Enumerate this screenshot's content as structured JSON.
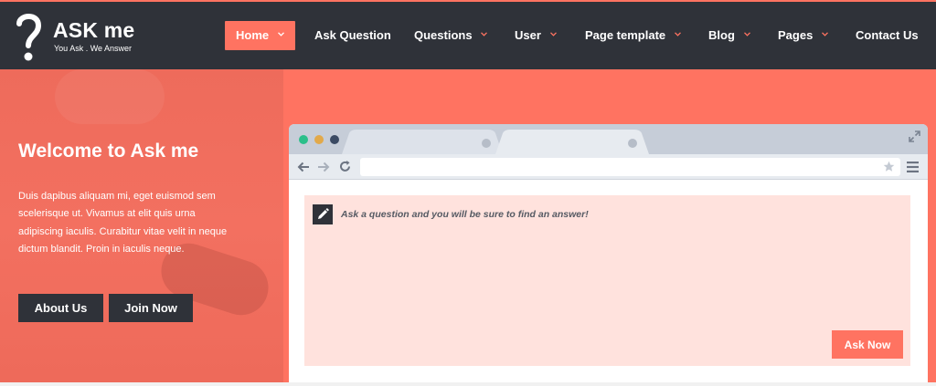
{
  "brand": {
    "name": "ASK me",
    "tagline": "You Ask . We Answer"
  },
  "nav": {
    "items": [
      {
        "label": "Home",
        "dropdown": true,
        "active": true
      },
      {
        "label": "Ask Question",
        "dropdown": false
      },
      {
        "label": "Questions",
        "dropdown": true
      },
      {
        "label": "User",
        "dropdown": true
      },
      {
        "label": "Page template",
        "dropdown": true
      },
      {
        "label": "Blog",
        "dropdown": true
      },
      {
        "label": "Pages",
        "dropdown": true
      },
      {
        "label": "Contact Us",
        "dropdown": false
      }
    ]
  },
  "hero": {
    "title": "Welcome to Ask me",
    "text": "Duis dapibus aliquam mi, eget euismod sem scelerisque ut. Vivamus at elit quis urna adipiscing iaculis. Curabitur vitae velit in neque dictum blandit. Proin in iaculis neque.",
    "buttons": {
      "about": "About Us",
      "join": "Join Now"
    }
  },
  "browser": {
    "url": "",
    "window_dots": [
      "#2bbf8a",
      "#e2a94a",
      "#3b4a63"
    ]
  },
  "ask_box": {
    "prompt": "Ask a question and you will be sure to find an answer!",
    "button": "Ask Now"
  },
  "colors": {
    "accent": "#ff7361",
    "dark": "#2f3239",
    "panel": "#ffe2dd"
  },
  "icons": {
    "logo": "question-mark-logo-icon",
    "dropdown": "chevron-down-icon",
    "back": "arrow-left-icon",
    "forward": "arrow-right-icon",
    "reload": "reload-icon",
    "bookmark": "star-icon",
    "menu": "hamburger-menu-icon",
    "fullscreen": "expand-icon",
    "edit": "pencil-icon"
  }
}
